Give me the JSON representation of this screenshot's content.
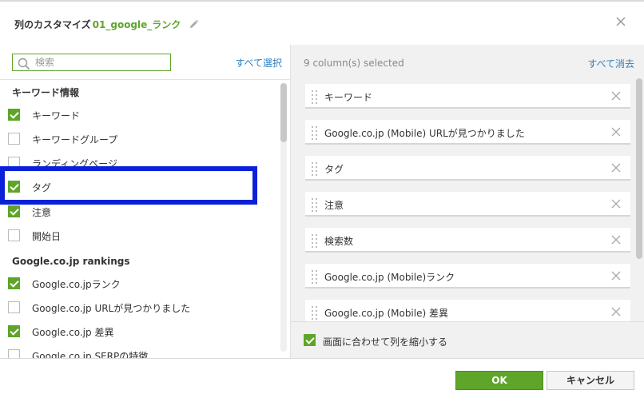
{
  "header": {
    "title": "列のカスタマイズ",
    "name": "01_google_ランク",
    "edit_icon": "pencil-icon",
    "close_icon": "close-icon"
  },
  "left": {
    "search_placeholder": "検索",
    "search_value": "",
    "select_all": "すべて選択",
    "groups": [
      {
        "title": "キーワード情報"
      },
      {
        "title": "Google.co.jp rankings"
      }
    ],
    "items": [
      {
        "label": "キーワード",
        "checked": true
      },
      {
        "label": "キーワードグループ",
        "checked": false
      },
      {
        "label": "ランディングページ",
        "checked": false
      },
      {
        "label": "タグ",
        "checked": true
      },
      {
        "label": "注意",
        "checked": true
      },
      {
        "label": "開始日",
        "checked": false
      },
      {
        "label": "Google.co.jpランク",
        "checked": true
      },
      {
        "label": "Google.co.jp URLが見つかりました",
        "checked": false
      },
      {
        "label": "Google.co.jp 差異",
        "checked": true
      },
      {
        "label": "Google.co.jp SERPの特徴",
        "checked": false
      }
    ]
  },
  "right": {
    "selected_count": "9 column(s) selected",
    "clear_all": "すべて消去",
    "selected": [
      {
        "label": "キーワード"
      },
      {
        "label": "Google.co.jp (Mobile) URLが見つかりました"
      },
      {
        "label": "タグ"
      },
      {
        "label": "注意"
      },
      {
        "label": "検索数"
      },
      {
        "label": "Google.co.jp (Mobile)ランク"
      },
      {
        "label": "Google.co.jp (Mobile) 差異"
      }
    ],
    "fit_label": "画面に合わせて列を縮小する",
    "fit_checked": true
  },
  "footer": {
    "ok": "OK",
    "cancel": "キャンセル"
  },
  "colors": {
    "accent": "#5ea52a",
    "link": "#2d7fc1",
    "highlight": "#0b21d9"
  }
}
